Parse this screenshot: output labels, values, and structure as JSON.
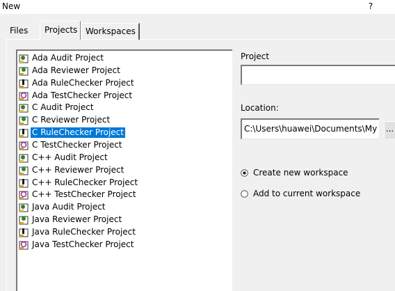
{
  "window": {
    "title": "New",
    "help_label": "?"
  },
  "tabs": [
    {
      "label": "Files"
    },
    {
      "label": "Projects"
    },
    {
      "label": "Workspaces"
    }
  ],
  "project_types": [
    {
      "label": "Ada Audit Project",
      "icon": "audit-icon"
    },
    {
      "label": "Ada Reviewer Project",
      "icon": "reviewer-icon"
    },
    {
      "label": "Ada RuleChecker Project",
      "icon": "rulechecker-icon"
    },
    {
      "label": "Ada TestChecker Project",
      "icon": "testchecker-icon"
    },
    {
      "label": "C Audit Project",
      "icon": "audit-icon"
    },
    {
      "label": "C Reviewer Project",
      "icon": "reviewer-icon"
    },
    {
      "label": "C RuleChecker Project",
      "icon": "rulechecker-icon",
      "selected": true
    },
    {
      "label": "C TestChecker Project",
      "icon": "testchecker-icon"
    },
    {
      "label": "C++ Audit Project",
      "icon": "audit-icon"
    },
    {
      "label": "C++ Reviewer Project",
      "icon": "reviewer-icon"
    },
    {
      "label": "C++ RuleChecker Project",
      "icon": "rulechecker-icon"
    },
    {
      "label": "C++ TestChecker Project",
      "icon": "testchecker-icon"
    },
    {
      "label": "Java Audit Project",
      "icon": "audit-icon"
    },
    {
      "label": "Java Reviewer Project",
      "icon": "reviewer-icon"
    },
    {
      "label": "Java RuleChecker Project",
      "icon": "rulechecker-icon"
    },
    {
      "label": "Java TestChecker Project",
      "icon": "testchecker-icon"
    }
  ],
  "project_field": {
    "label": "Project",
    "value": ""
  },
  "location_field": {
    "label": "Location:",
    "value": "C:\\Users\\huawei\\Documents\\My P"
  },
  "browse_label": "...",
  "workspace_options": [
    {
      "label": "Create new workspace",
      "checked": true
    },
    {
      "label": "Add to current workspace",
      "checked": false
    }
  ],
  "colors": {
    "selection": "#0078d7",
    "dialog_bg": "#f0f0f0"
  }
}
